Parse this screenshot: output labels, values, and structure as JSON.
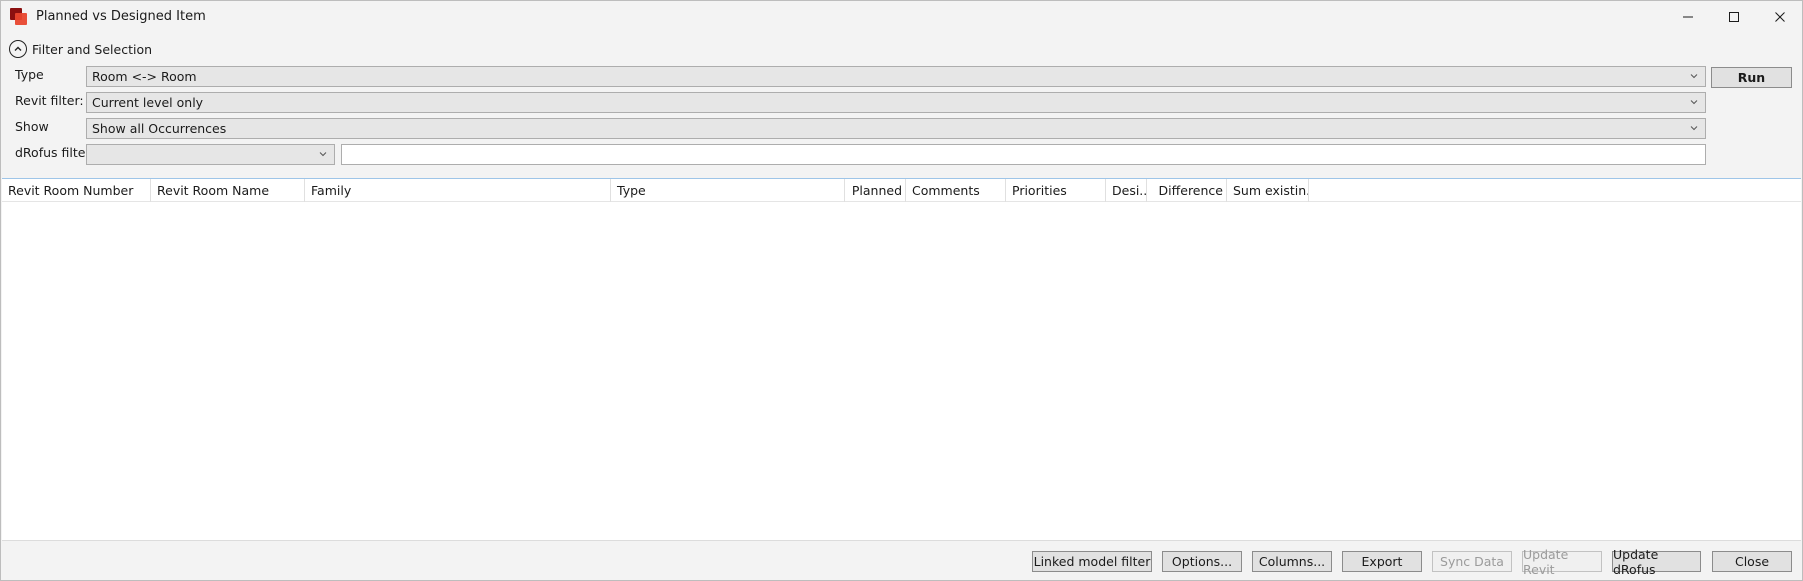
{
  "window": {
    "title": "Planned vs Designed Item"
  },
  "filter_section": {
    "title": "Filter and Selection",
    "type_label": "Type",
    "type_value": "Room <-> Room",
    "revit_filter_label": "Revit filter:",
    "revit_filter_value": "Current level only",
    "show_label": "Show",
    "show_value": "Show all Occurrences",
    "drofus_filter_label": "dRofus filter:",
    "drofus_filter_value": "",
    "drofus_filter_text": "",
    "run_label": "Run"
  },
  "grid": {
    "columns": [
      "Revit Room Number",
      "Revit Room Name",
      "Family",
      "Type",
      "Planned",
      "Comments",
      "Priorities",
      "Desi...",
      "Difference",
      "Sum existin..."
    ]
  },
  "footer": {
    "linked_model_filter": "Linked model filter",
    "options": "Options...",
    "columns": "Columns...",
    "export": "Export",
    "sync_data": "Sync Data",
    "update_revit": "Update Revit",
    "update_drofus": "Update dRofus",
    "close": "Close"
  },
  "icons": {
    "app": "app-icon",
    "minimize": "minimize-icon",
    "maximize": "maximize-icon",
    "close": "close-icon",
    "collapse": "chevron-up-circle-icon",
    "dropdown": "chevron-down-icon"
  }
}
